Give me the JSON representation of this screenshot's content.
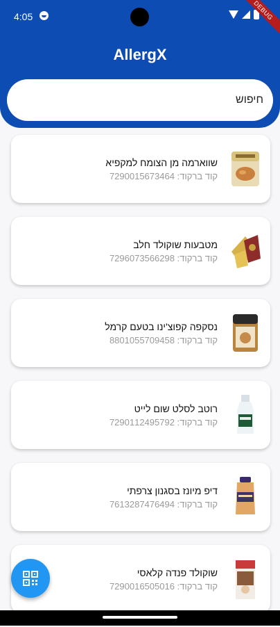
{
  "status_bar": {
    "time": "4:05",
    "debug_label": "DEBUG"
  },
  "app_bar": {
    "title": "AllergX"
  },
  "search": {
    "placeholder": "חיפוש"
  },
  "products": [
    {
      "name": "שווארמה מן הצומח למקפיא",
      "barcode": "קוד ברקוד: 7290015673464"
    },
    {
      "name": "מטבעות שוקולד חלב",
      "barcode": "קוד ברקוד: 7296073566298"
    },
    {
      "name": "נסקפה קפוצ'ינו בטעם קרמל",
      "barcode": "קוד ברקוד: 8801055709458"
    },
    {
      "name": "רוטב לסלט שום לייט",
      "barcode": "קוד ברקוד: 7290112495792"
    },
    {
      "name": "דיפ מיונז בסגנון צרפתי",
      "barcode": "קוד ברקוד: 7613287476494"
    },
    {
      "name": "שוקולד פנדה קלאסי",
      "barcode": "קוד ברקוד: 7290016505016"
    }
  ],
  "icons": {
    "fab": "qr-code-scan-icon"
  },
  "colors": {
    "primary": "#0d4cb3",
    "fab": "#2196f3",
    "debug": "#b71c1c"
  }
}
